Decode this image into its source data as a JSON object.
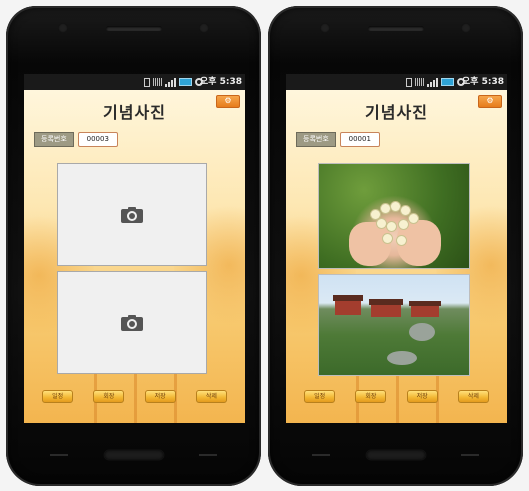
{
  "status_bar": {
    "time": "오후 5:38"
  },
  "screens": [
    {
      "title": "기념사진",
      "settings_icon": "gear-icon",
      "registration": {
        "label": "등록번호",
        "value": "00003"
      },
      "photos": [
        {
          "state": "empty",
          "icon": "camera-icon"
        },
        {
          "state": "empty",
          "icon": "camera-icon"
        }
      ],
      "buttons": [
        "일정",
        "회장",
        "저장",
        "삭제"
      ]
    },
    {
      "title": "기념사진",
      "settings_icon": "gear-icon",
      "registration": {
        "label": "등록번호",
        "value": "00001"
      },
      "photos": [
        {
          "state": "filled"
        },
        {
          "state": "filled"
        }
      ],
      "buttons": [
        "일정",
        "회장",
        "저장",
        "삭제"
      ]
    }
  ]
}
